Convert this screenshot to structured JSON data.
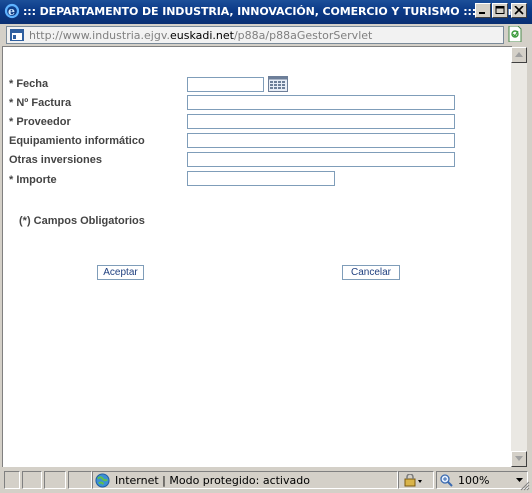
{
  "window": {
    "title": "::: DEPARTAMENTO DE INDUSTRIA, INNOVACIÓN, COMERCIO Y TURISMO :::. - Win...",
    "title_bg": "#0b3a87"
  },
  "address": {
    "url_prefix": "http://www.industria.ejgv.",
    "url_domain": "euskadi.net",
    "url_suffix": "/p88a/p88aGestorServlet"
  },
  "form": {
    "fields": [
      {
        "label": "* Fecha"
      },
      {
        "label": "* Nº Factura"
      },
      {
        "label": "* Proveedor"
      },
      {
        "label": "Equipamiento informático"
      },
      {
        "label": "Otras inversiones"
      },
      {
        "label": "* Importe"
      }
    ],
    "mandatory_note": "(*)  Campos Obligatorios",
    "accept_label": "Aceptar",
    "cancel_label": "Cancelar"
  },
  "statusbar": {
    "zone_text": "Internet | Modo protegido: activado",
    "zoom": "100%"
  }
}
